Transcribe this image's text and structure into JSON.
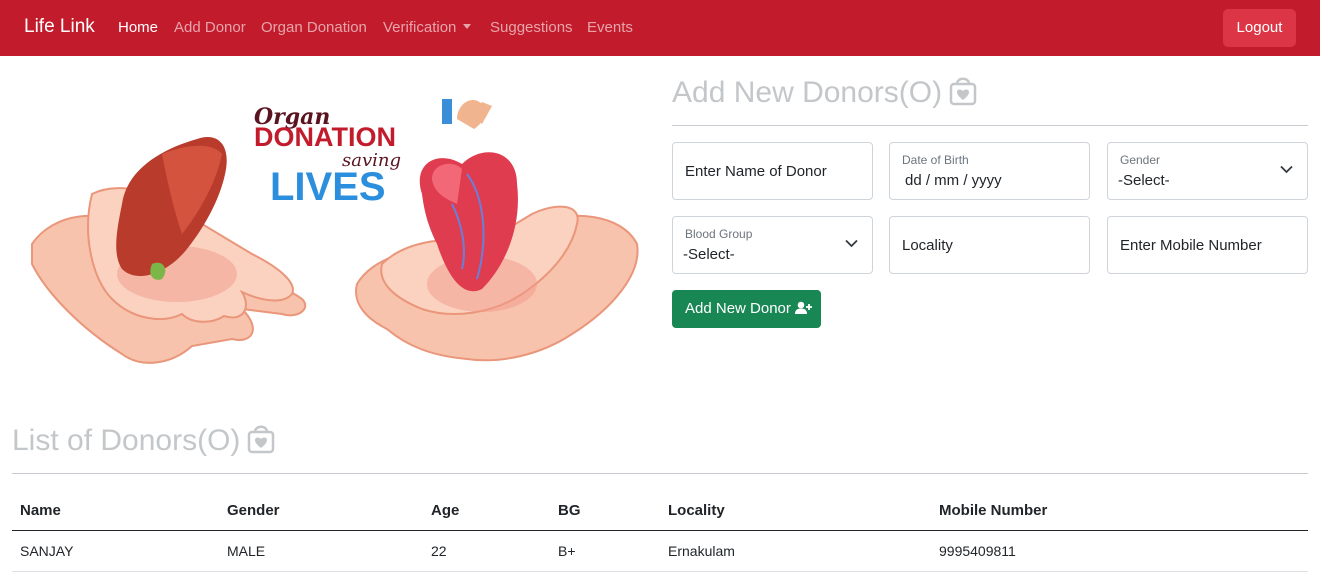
{
  "navbar": {
    "brand": "Life Link",
    "links": [
      "Home",
      "Add Donor",
      "Organ Donation",
      "Verification",
      "Suggestions",
      "Events"
    ],
    "logout": "Logout"
  },
  "illustration": {
    "line1": "Organ",
    "line2": "DONATION",
    "line3": "saving",
    "line4": "LIVES"
  },
  "form": {
    "title": "Add New Donors(O)",
    "name_placeholder": "Enter Name of Donor",
    "dob_label": "Date of Birth",
    "dob_value": "dd / mm / yyyy",
    "gender_label": "Gender",
    "gender_value": "-Select-",
    "blood_label": "Blood Group",
    "blood_value": "-Select-",
    "locality_placeholder": "Locality",
    "mobile_placeholder": "Enter Mobile Number",
    "submit": "Add New Donor"
  },
  "list": {
    "title": "List of Donors(O)",
    "columns": [
      "Name",
      "Gender",
      "Age",
      "BG",
      "Locality",
      "Mobile Number"
    ],
    "rows": [
      [
        "SANJAY",
        "MALE",
        "22",
        "B+",
        "Ernakulam",
        "9995409811"
      ]
    ]
  }
}
